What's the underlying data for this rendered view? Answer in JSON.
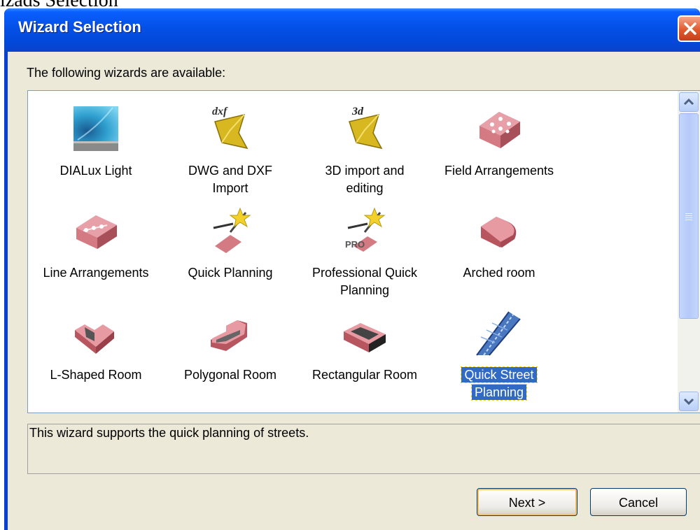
{
  "background_caption": "izads Selection",
  "window": {
    "title": "Wizard Selection",
    "close_icon": "close-icon"
  },
  "subtitle": "The following wizards are available:",
  "wizards": [
    {
      "label": "DIALux Light",
      "icon": "dialux-light-icon",
      "selected": false
    },
    {
      "label": "DWG and DXF Import",
      "icon": "dxf-import-icon",
      "selected": false
    },
    {
      "label": "3D import and editing",
      "icon": "3d-import-icon",
      "selected": false
    },
    {
      "label": "Field Arrangements",
      "icon": "field-arrangements-icon",
      "selected": false
    },
    {
      "label": "Line Arrangements",
      "icon": "line-arrangements-icon",
      "selected": false
    },
    {
      "label": "Quick Planning",
      "icon": "quick-planning-icon",
      "selected": false
    },
    {
      "label": "Professional Quick Planning",
      "icon": "pro-quick-planning-icon",
      "selected": false
    },
    {
      "label": "Arched room",
      "icon": "arched-room-icon",
      "selected": false
    },
    {
      "label": "L-Shaped Room",
      "icon": "l-shaped-room-icon",
      "selected": false
    },
    {
      "label": "Polygonal Room",
      "icon": "polygonal-room-icon",
      "selected": false
    },
    {
      "label": "Rectangular Room",
      "icon": "rectangular-room-icon",
      "selected": false
    },
    {
      "label": "Quick Street Planning",
      "icon": "street-planning-icon",
      "selected": true
    }
  ],
  "description": "This wizard supports the quick planning of streets.",
  "buttons": {
    "next": "Next >",
    "cancel": "Cancel"
  },
  "colors": {
    "titlebar": "#0450e6",
    "selection": "#316ac5",
    "dialog_bg": "#ece9d8"
  }
}
